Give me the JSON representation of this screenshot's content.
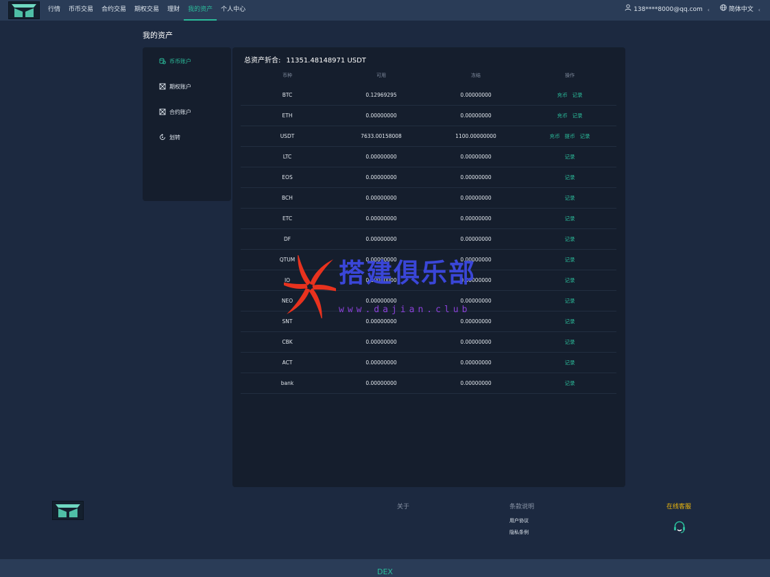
{
  "nav": {
    "items": [
      {
        "label": "行情",
        "active": false
      },
      {
        "label": "币币交易",
        "active": false
      },
      {
        "label": "合约交易",
        "active": false
      },
      {
        "label": "期权交易",
        "active": false
      },
      {
        "label": "理财",
        "active": false
      },
      {
        "label": "我的资产",
        "active": true
      },
      {
        "label": "个人中心",
        "active": false
      }
    ],
    "user_email": "138****8000@qq.com",
    "language": "简体中文"
  },
  "page_title": "我的资产",
  "sidebar": {
    "items": [
      {
        "label": "币币账户",
        "icon": "coin-stack-icon",
        "active": true
      },
      {
        "label": "期权账户",
        "icon": "options-icon",
        "active": false
      },
      {
        "label": "合约账户",
        "icon": "contract-icon",
        "active": false
      },
      {
        "label": "划转",
        "icon": "transfer-icon",
        "active": false
      }
    ]
  },
  "assets": {
    "total_label": "总资产折合:",
    "total_value": "11351.48148971 USDT",
    "columns": [
      "币种",
      "可用",
      "冻结",
      "操作"
    ],
    "rows": [
      {
        "coin": "BTC",
        "available": "0.12969295",
        "frozen": "0.00000000",
        "actions": [
          "充币",
          "记录"
        ]
      },
      {
        "coin": "ETH",
        "available": "0.00000000",
        "frozen": "0.00000000",
        "actions": [
          "充币",
          "记录"
        ]
      },
      {
        "coin": "USDT",
        "available": "7633.00158008",
        "frozen": "1100.00000000",
        "actions": [
          "充币",
          "提币",
          "记录"
        ]
      },
      {
        "coin": "LTC",
        "available": "0.00000000",
        "frozen": "0.00000000",
        "actions": [
          "记录"
        ]
      },
      {
        "coin": "EOS",
        "available": "0.00000000",
        "frozen": "0.00000000",
        "actions": [
          "记录"
        ]
      },
      {
        "coin": "BCH",
        "available": "0.00000000",
        "frozen": "0.00000000",
        "actions": [
          "记录"
        ]
      },
      {
        "coin": "ETC",
        "available": "0.00000000",
        "frozen": "0.00000000",
        "actions": [
          "记录"
        ]
      },
      {
        "coin": "DF",
        "available": "0.00000000",
        "frozen": "0.00000000",
        "actions": [
          "记录"
        ]
      },
      {
        "coin": "QTUM",
        "available": "0.00000000",
        "frozen": "0.00000000",
        "actions": [
          "记录"
        ]
      },
      {
        "coin": "IO",
        "available": "0.00000000",
        "frozen": "0.00000000",
        "actions": [
          "记录"
        ]
      },
      {
        "coin": "NEO",
        "available": "0.00000000",
        "frozen": "0.00000000",
        "actions": [
          "记录"
        ]
      },
      {
        "coin": "SNT",
        "available": "0.00000000",
        "frozen": "0.00000000",
        "actions": [
          "记录"
        ]
      },
      {
        "coin": "CBK",
        "available": "0.00000000",
        "frozen": "0.00000000",
        "actions": [
          "记录"
        ]
      },
      {
        "coin": "ACT",
        "available": "0.00000000",
        "frozen": "0.00000000",
        "actions": [
          "记录"
        ]
      },
      {
        "coin": "bank",
        "available": "0.00000000",
        "frozen": "0.00000000",
        "actions": [
          "记录"
        ]
      }
    ]
  },
  "watermark": {
    "text": "搭建俱乐部",
    "url": "www.dajian.club"
  },
  "footer": {
    "about": "关于",
    "terms_title": "条款说明",
    "links": [
      "用户协议",
      "隐私条例"
    ],
    "online_service": "在线客服",
    "bottom_text": "DEX"
  },
  "colors": {
    "accent": "#2bbd9b",
    "service": "#f0b90b",
    "background": "#1c2940",
    "panel": "#151e2d",
    "watermark_blue": "#3a46d8",
    "watermark_red": "#e8321e"
  }
}
